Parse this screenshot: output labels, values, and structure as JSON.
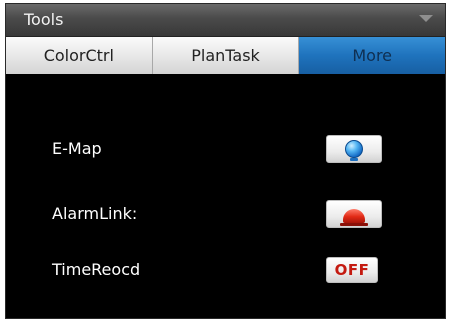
{
  "panel": {
    "title": "Tools"
  },
  "tabs": [
    {
      "label": "ColorCtrl",
      "active": false
    },
    {
      "label": "PlanTask",
      "active": false
    },
    {
      "label": "More",
      "active": true
    }
  ],
  "rows": [
    {
      "label": "E-Map",
      "button_icon": "globe-icon"
    },
    {
      "label": "AlarmLink:",
      "button_icon": "alarm-light-icon"
    },
    {
      "label": "TimeReocd",
      "button_text": "OFF"
    }
  ],
  "colors": {
    "panel_bg": "#000000",
    "tab_active": "#1f73bd",
    "off_text": "#c41a10"
  }
}
